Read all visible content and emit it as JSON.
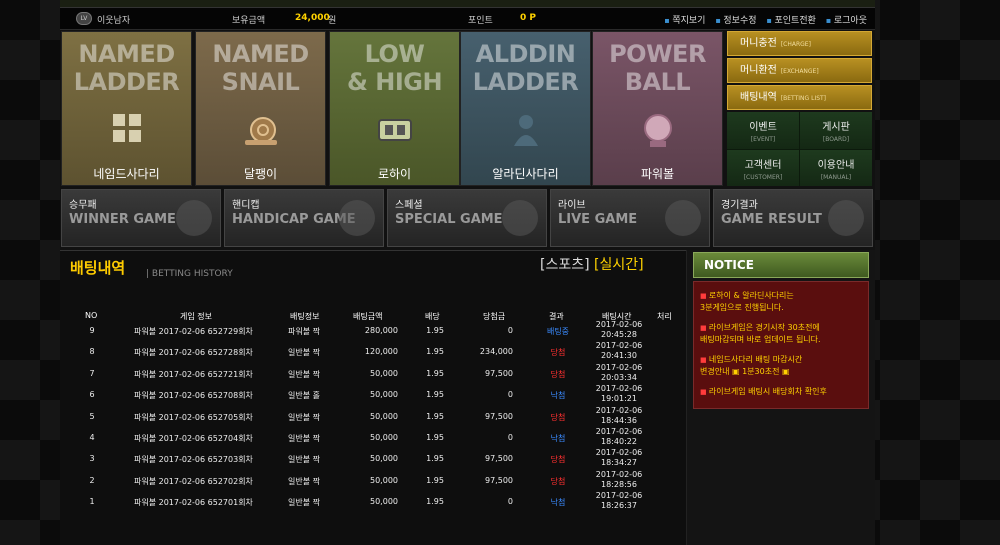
{
  "topbar": {
    "level_badge": "LV",
    "nickname": "이웃남자",
    "balance_label": "보유금액",
    "balance_value": "24,000",
    "balance_unit": "원",
    "points_label": "포인트",
    "points_value": "0 P",
    "links": [
      "쪽지보기",
      "정보수정",
      "포인트전환",
      "로그아웃"
    ]
  },
  "games": [
    {
      "en1": "NAMED",
      "en2": "LADDER",
      "ko": "네임드사다리",
      "icon": "named-ladder-icon"
    },
    {
      "en1": "NAMED",
      "en2": "SNAIL",
      "ko": "달팽이",
      "icon": "snail-icon"
    },
    {
      "en1": "LOW",
      "en2": "& HIGH",
      "ko": "로하이",
      "icon": "low-high-icon"
    },
    {
      "en1": "ALDDIN",
      "en2": "LADDER",
      "ko": "알라딘사다리",
      "icon": "genie-icon"
    },
    {
      "en1": "POWER",
      "en2": "BALL",
      "ko": "파워볼",
      "icon": "powerball-icon"
    }
  ],
  "side_buttons": [
    {
      "ko": "머니충전",
      "en": "[CHARGE]"
    },
    {
      "ko": "머니환전",
      "en": "[EXCHANGE]"
    },
    {
      "ko": "배팅내역",
      "en": "[BETTING LIST]"
    }
  ],
  "side_grid": [
    {
      "ko": "이벤트",
      "en": "[EVENT]"
    },
    {
      "ko": "게시판",
      "en": "[BOARD]"
    },
    {
      "ko": "고객센터",
      "en": "[CUSTOMER]"
    },
    {
      "ko": "이용안내",
      "en": "[MANUAL]"
    }
  ],
  "categories": [
    {
      "ko": "승무패",
      "en": "WINNER GAME"
    },
    {
      "ko": "핸디캡",
      "en": "HANDICAP GAME"
    },
    {
      "ko": "스페셜",
      "en": "SPECIAL GAME"
    },
    {
      "ko": "라이브",
      "en": "LIVE GAME"
    },
    {
      "ko": "경기결과",
      "en": "GAME RESULT"
    }
  ],
  "history": {
    "title": "배팅내역",
    "subtitle": "| BETTING HISTORY",
    "tab_sports": "[스포츠]",
    "tab_live": "[실시간]",
    "columns": [
      "NO",
      "게임 정보",
      "배팅정보",
      "배팅금액",
      "배당",
      "당첨금",
      "결과",
      "배팅시간",
      "처리"
    ],
    "rows": [
      {
        "no": "9",
        "info": "파워볼 2017-02-06 652729회차",
        "bet": "파워볼 짝",
        "amount": "280,000",
        "odds": "1.95",
        "win": "0",
        "result": "배팅중",
        "status": "pend",
        "date": "2017-02-06",
        "time": "20:45:28"
      },
      {
        "no": "8",
        "info": "파워볼 2017-02-06 652728회차",
        "bet": "일반볼 짝",
        "amount": "120,000",
        "odds": "1.95",
        "win": "234,000",
        "result": "당첨",
        "status": "win",
        "date": "2017-02-06",
        "time": "20:41:30"
      },
      {
        "no": "7",
        "info": "파워볼 2017-02-06 652721회차",
        "bet": "일반볼 짝",
        "amount": "50,000",
        "odds": "1.95",
        "win": "97,500",
        "result": "당첨",
        "status": "win",
        "date": "2017-02-06",
        "time": "20:03:34"
      },
      {
        "no": "6",
        "info": "파워볼 2017-02-06 652708회차",
        "bet": "일반볼 홀",
        "amount": "50,000",
        "odds": "1.95",
        "win": "0",
        "result": "낙첨",
        "status": "lose",
        "date": "2017-02-06",
        "time": "19:01:21"
      },
      {
        "no": "5",
        "info": "파워볼 2017-02-06 652705회차",
        "bet": "일반볼 짝",
        "amount": "50,000",
        "odds": "1.95",
        "win": "97,500",
        "result": "당첨",
        "status": "win",
        "date": "2017-02-06",
        "time": "18:44:36"
      },
      {
        "no": "4",
        "info": "파워볼 2017-02-06 652704회차",
        "bet": "일반볼 짝",
        "amount": "50,000",
        "odds": "1.95",
        "win": "0",
        "result": "낙첨",
        "status": "lose",
        "date": "2017-02-06",
        "time": "18:40:22"
      },
      {
        "no": "3",
        "info": "파워볼 2017-02-06 652703회차",
        "bet": "일반볼 짝",
        "amount": "50,000",
        "odds": "1.95",
        "win": "97,500",
        "result": "당첨",
        "status": "win",
        "date": "2017-02-06",
        "time": "18:34:27"
      },
      {
        "no": "2",
        "info": "파워볼 2017-02-06 652702회차",
        "bet": "일반볼 짝",
        "amount": "50,000",
        "odds": "1.95",
        "win": "97,500",
        "result": "당첨",
        "status": "win",
        "date": "2017-02-06",
        "time": "18:28:56"
      },
      {
        "no": "1",
        "info": "파워볼 2017-02-06 652701회차",
        "bet": "일반볼 짝",
        "amount": "50,000",
        "odds": "1.95",
        "win": "0",
        "result": "낙첨",
        "status": "lose",
        "date": "2017-02-06",
        "time": "18:26:37"
      }
    ]
  },
  "notice": {
    "title": "NOTICE",
    "items": [
      {
        "line1": "로하이 & 알라딘사다리는",
        "line2": "3분게임으로 진행됩니다."
      },
      {
        "line1": "라이브게임은 경기시작 30초전에",
        "line2": "배팅마감되며 바로 업데이트 됩니다."
      },
      {
        "line1": "네임드사다리 배팅 마감시간",
        "line2": "변경안내 ▣ 1분30초전 ▣"
      },
      {
        "line1": "라이브게임 배팅시 배당회차 확인후",
        "line2": ""
      }
    ]
  },
  "colors": {
    "accent_gold": "#ffd200",
    "win": "#ff3030",
    "lose": "#3a8bff"
  }
}
